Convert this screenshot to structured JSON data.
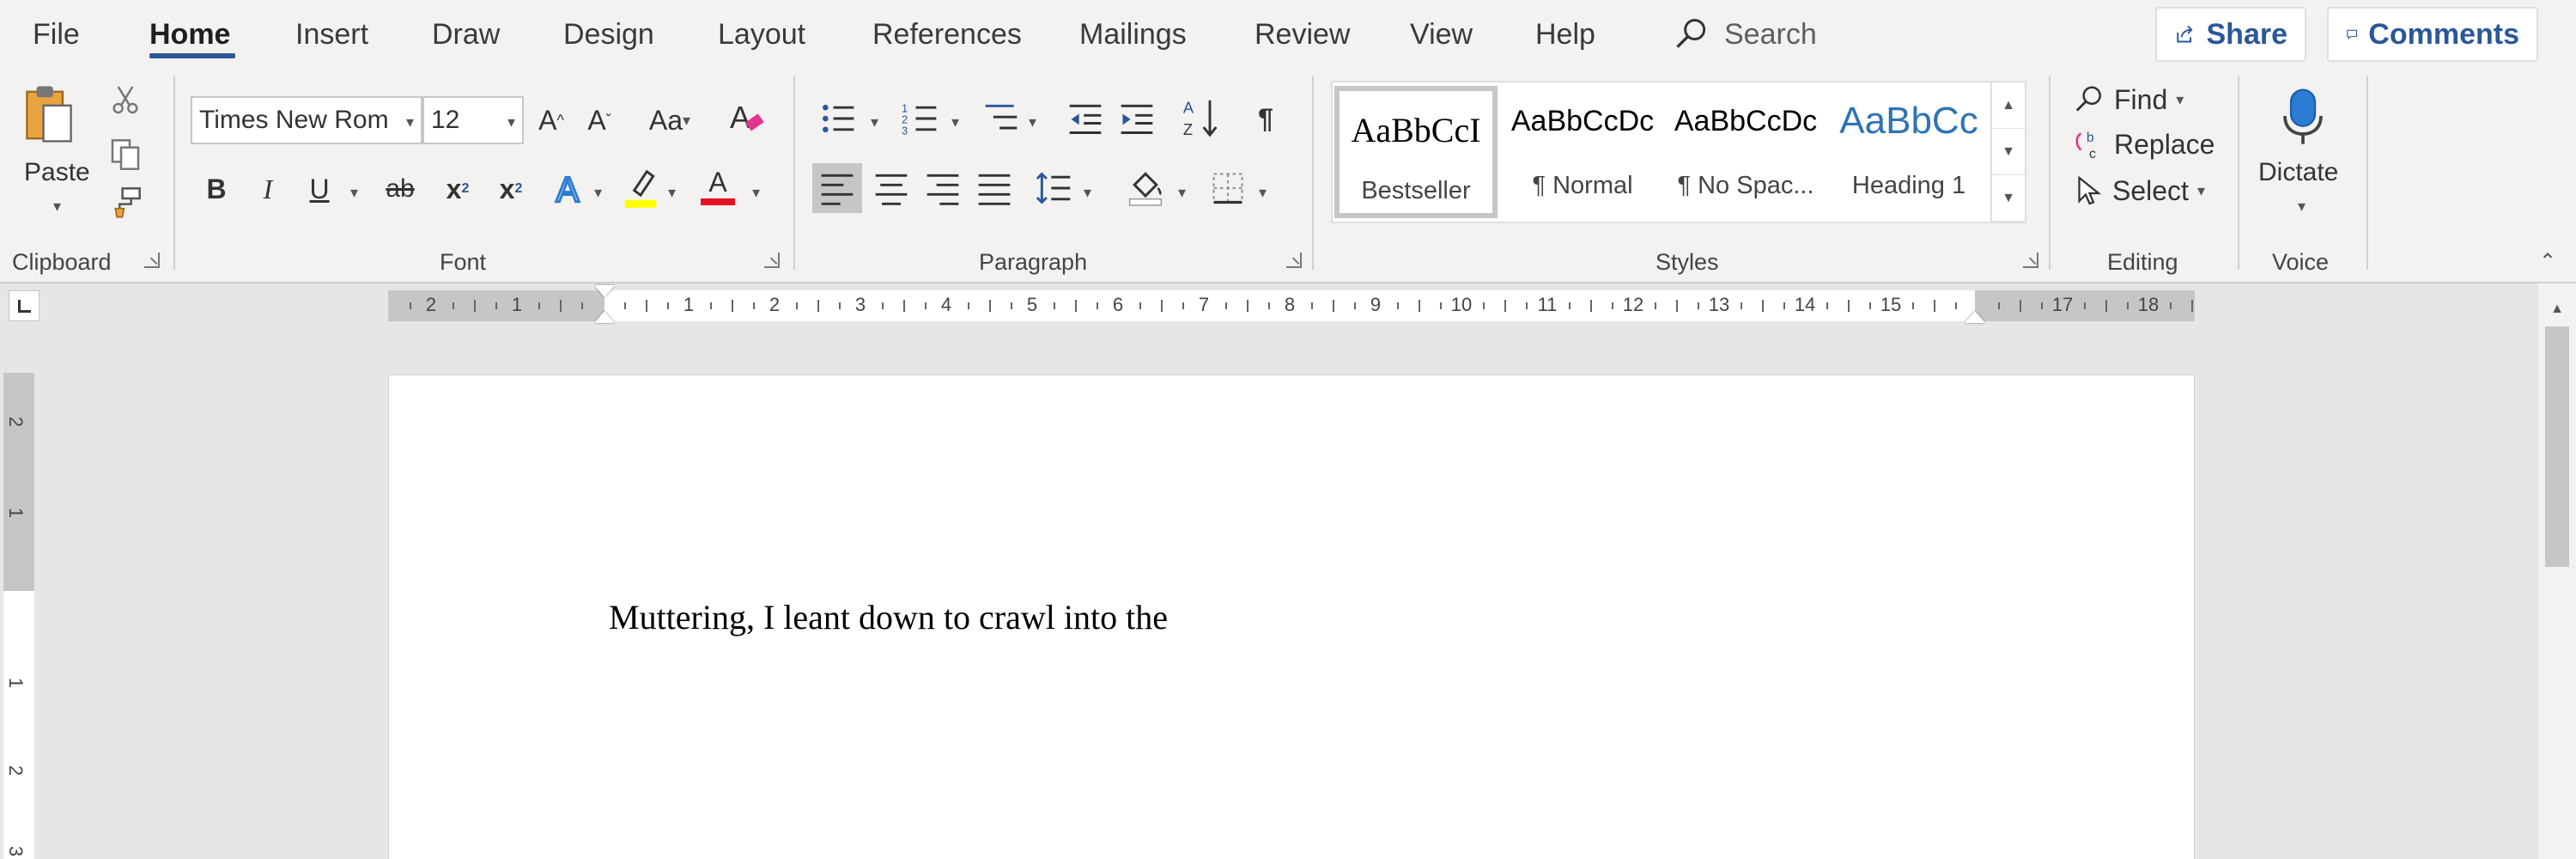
{
  "menu": {
    "tabs": [
      "File",
      "Home",
      "Insert",
      "Draw",
      "Design",
      "Layout",
      "References",
      "Mailings",
      "Review",
      "View",
      "Help"
    ],
    "active_tab": "Home",
    "search_label": "Search",
    "share_label": "Share",
    "comments_label": "Comments"
  },
  "ribbon": {
    "clipboard": {
      "paste_label": "Paste",
      "group_label": "Clipboard"
    },
    "font": {
      "font_name": "Times New Rom",
      "font_size": "12",
      "grow_label": "A",
      "shrink_label": "A",
      "change_case_label": "Aa",
      "bold": "B",
      "italic": "I",
      "underline": "U",
      "strike": "ab",
      "subscript": "x",
      "superscript": "x",
      "font_color_letter": "A",
      "highlight_color": "#ffff00",
      "font_color": "#e81123",
      "group_label": "Font"
    },
    "paragraph": {
      "group_label": "Paragraph",
      "pilcrow": "¶"
    },
    "styles": {
      "items": [
        {
          "preview": "AaBbCcI",
          "name": "Bestseller"
        },
        {
          "preview": "AaBbCcDc",
          "name": "¶ Normal"
        },
        {
          "preview": "AaBbCcDc",
          "name": "¶ No Spac..."
        },
        {
          "preview": "AaBbCc",
          "name": "Heading 1"
        }
      ],
      "selected": "Bestseller",
      "heading_color": "#2e74b5",
      "group_label": "Styles"
    },
    "editing": {
      "find_label": "Find",
      "replace_label": "Replace",
      "select_label": "Select",
      "group_label": "Editing"
    },
    "voice": {
      "dictate_label": "Dictate",
      "group_label": "Voice"
    }
  },
  "rulers": {
    "horizontal": [
      "2",
      "1",
      "1",
      "2",
      "3",
      "4",
      "5",
      "6",
      "7",
      "8",
      "9",
      "10",
      "11",
      "12",
      "13",
      "14",
      "15",
      "17",
      "18"
    ],
    "vertical": [
      "2",
      "1",
      "1",
      "2",
      "3"
    ]
  },
  "document": {
    "text": "Muttering, I leant down to crawl into the"
  },
  "colors": {
    "accent": "#2b579a",
    "ribbon_bg": "#f3f2f1",
    "canvas_bg": "#e6e6e6"
  }
}
